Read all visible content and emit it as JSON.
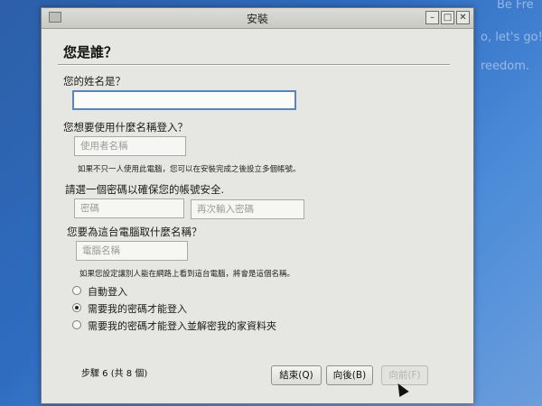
{
  "desktop": {
    "lines": [
      "Be Fre",
      "o, let's go!",
      "reedom."
    ]
  },
  "window": {
    "title": "安裝",
    "heading": "您是誰？"
  },
  "form": {
    "name_label": "您的姓名是？",
    "name_value": "",
    "login_label": "您想要使用什麼名稱登入？",
    "username_placeholder": "使用者名稱",
    "login_note": "如果不只一人使用此電腦，您可以在安裝完成之後設立多個帳號。",
    "password_label": "請選一個密碼以確保您的帳號安全.",
    "password_placeholder": "密碼",
    "password_repeat_placeholder": "再次輸入密碼",
    "computer_label": "您要為這台電腦取什麼名稱？",
    "computer_placeholder": "電腦名稱",
    "computer_note": "如果您設定讓別人能在網路上看到這台電腦，將會是這個名稱。"
  },
  "login_options": [
    {
      "label": "自動登入",
      "checked": false
    },
    {
      "label": "需要我的密碼才能登入",
      "checked": true
    },
    {
      "label": "需要我的密碼才能登入並解密我的家資料夾",
      "checked": false
    }
  ],
  "footer": {
    "step": "步驟 6 (共 8 個)",
    "quit": "結束(Q)",
    "back": "向後(B)",
    "forward": "向前(F)"
  }
}
